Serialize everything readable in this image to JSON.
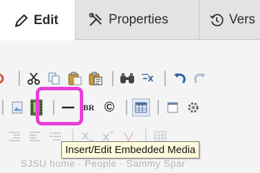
{
  "tabs": [
    {
      "label": "Edit",
      "icon": "pencil-icon",
      "active": true
    },
    {
      "label": "Properties",
      "icon": "tools-icon",
      "active": false
    },
    {
      "label": "Vers",
      "icon": "history-icon",
      "active": false
    }
  ],
  "toolbar": {
    "insert_br_label": "BR",
    "copyright_glyph": "©"
  },
  "tooltip": {
    "text": "Insert/Edit Embedded Media"
  },
  "breadcrumb": {
    "text": "SJSU home · People · Sammy Spar"
  },
  "colors": {
    "highlight": "#e83fd8",
    "tooltip_bg": "#fffbdc",
    "active_tab_bg": "#ffffff"
  }
}
